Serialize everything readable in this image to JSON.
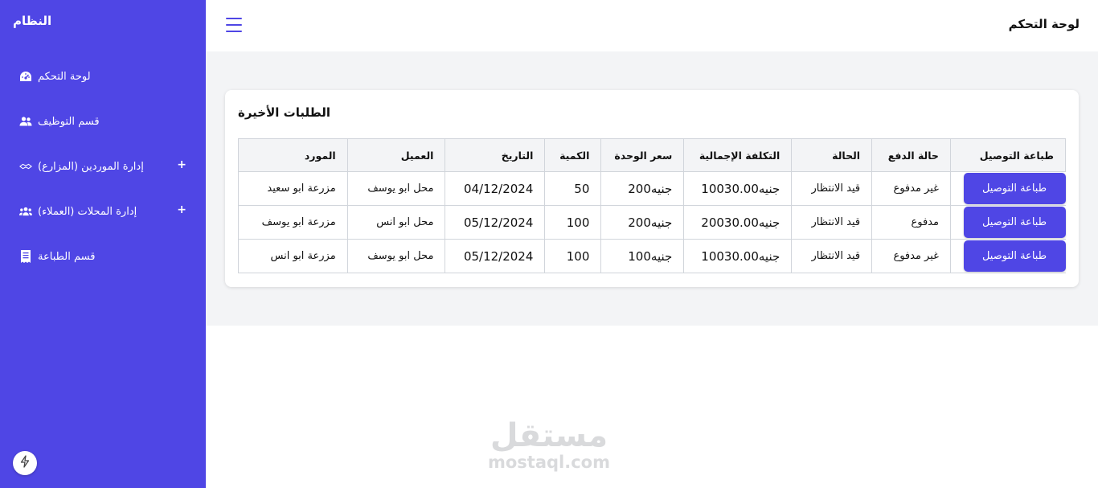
{
  "sidebar": {
    "brand": "النظام",
    "items": [
      {
        "label": "لوحة التحكم",
        "icon": "dashboard-gauge-icon",
        "expandable": false
      },
      {
        "label": "قسم التوظيف",
        "icon": "users-icon",
        "expandable": false
      },
      {
        "label": "إدارة الموردين (المزارع)",
        "icon": "handshake-icon",
        "expandable": true
      },
      {
        "label": "إدارة المحلات (العملاء)",
        "icon": "user-group-icon",
        "expandable": true
      },
      {
        "label": "قسم الطباعة",
        "icon": "receipt-icon",
        "expandable": false
      }
    ],
    "expand_symbol": "+"
  },
  "header": {
    "title": "لوحة التحكم",
    "menu_icon": "hamburger-menu-icon"
  },
  "recent_orders": {
    "title": "الطلبات الأخيرة",
    "columns": [
      "المورد",
      "العميل",
      "التاريخ",
      "الكمية",
      "سعر الوحدة",
      "التكلفة الإجمالية",
      "الحالة",
      "حالة الدفع",
      "طباعة التوصيل"
    ],
    "rows": [
      {
        "supplier": "مزرعة ابو سعيد",
        "customer": "محل ابو يوسف",
        "date": "04/12/2024",
        "quantity": "50",
        "unit_price": "جنيه200",
        "total_cost": "جنيه10030.00",
        "status": "قيد الانتظار",
        "payment_status": "غير مدفوع",
        "print_label": "طباعة التوصيل"
      },
      {
        "supplier": "مزرعة ابو يوسف",
        "customer": "محل ابو انس",
        "date": "05/12/2024",
        "quantity": "100",
        "unit_price": "جنيه200",
        "total_cost": "جنيه20030.00",
        "status": "قيد الانتظار",
        "payment_status": "مدفوع",
        "print_label": "طباعة التوصيل"
      },
      {
        "supplier": "مزرعة ابو انس",
        "customer": "محل ابو يوسف",
        "date": "05/12/2024",
        "quantity": "100",
        "unit_price": "جنيه100",
        "total_cost": "جنيه10030.00",
        "status": "قيد الانتظار",
        "payment_status": "غير مدفوع",
        "print_label": "طباعة التوصيل"
      }
    ]
  },
  "watermark": {
    "arabic": "مستقل",
    "latin": "mostaql.com"
  },
  "colors": {
    "accent": "#4f46e5",
    "content_bg": "#f3f4f6",
    "border": "#d1d5db"
  }
}
